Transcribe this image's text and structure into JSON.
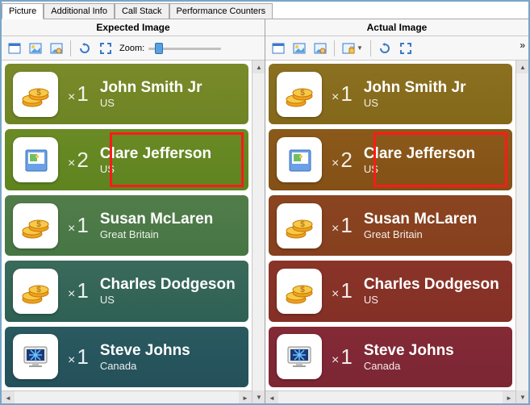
{
  "tabs": [
    "Picture",
    "Additional Info",
    "Call Stack",
    "Performance Counters"
  ],
  "active_tab": 0,
  "panes": {
    "expected": {
      "title": "Expected Image",
      "zoom_label": "Zoom:"
    },
    "actual": {
      "title": "Actual Image"
    }
  },
  "toolbar_icons": [
    "window-icon",
    "picture-icon",
    "picture-hand-icon",
    "picture-lock-dropdown-icon",
    "refresh-icon",
    "fit-icon"
  ],
  "rows": [
    {
      "icon": "coins",
      "qty": "1",
      "name": "John Smith Jr",
      "country": "US",
      "highlight": false
    },
    {
      "icon": "book",
      "qty": "2",
      "name": "Clare Jefferson",
      "country": "US",
      "highlight": true
    },
    {
      "icon": "coins",
      "qty": "1",
      "name": "Susan McLaren",
      "country": "Great Britain",
      "highlight": false
    },
    {
      "icon": "coins",
      "qty": "1",
      "name": "Charles Dodgeson",
      "country": "US",
      "highlight": false
    },
    {
      "icon": "monitor",
      "qty": "1",
      "name": "Steve Johns",
      "country": "Canada",
      "highlight": false
    }
  ]
}
